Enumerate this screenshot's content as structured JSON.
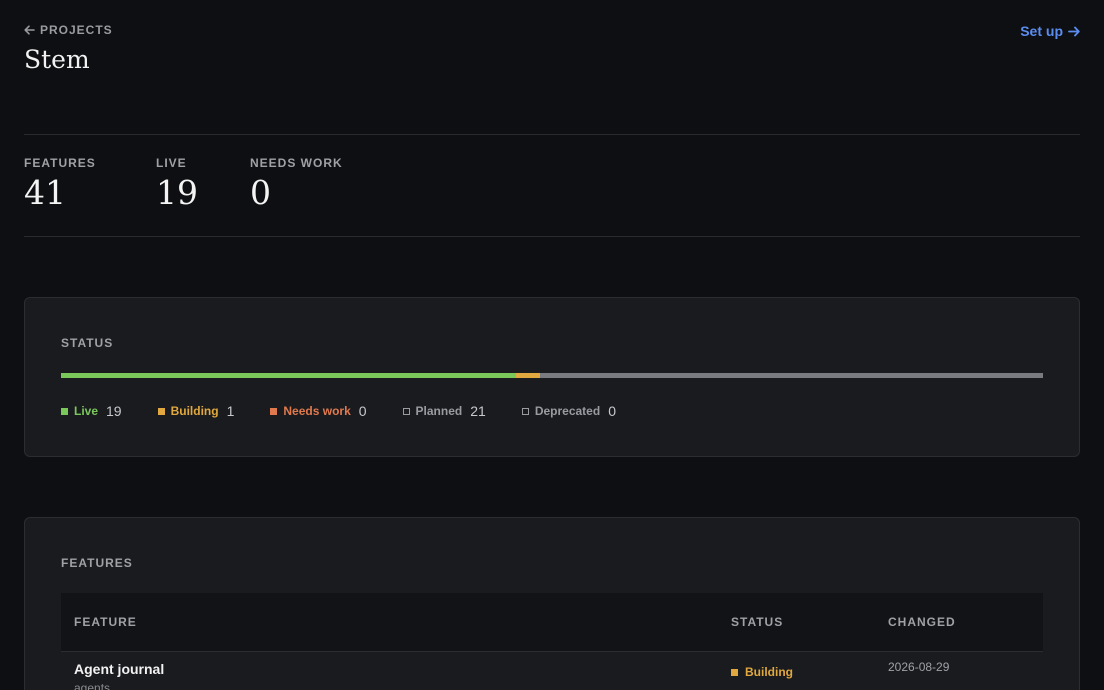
{
  "header": {
    "back_label": "PROJECTS",
    "title": "Stem",
    "setup_label": "Set up"
  },
  "stats": [
    {
      "label": "FEATURES",
      "value": "41"
    },
    {
      "label": "LIVE",
      "value": "19"
    },
    {
      "label": "NEEDS WORK",
      "value": "0"
    }
  ],
  "status_card": {
    "title": "STATUS",
    "total": 41,
    "items": [
      {
        "label": "Live",
        "count": "19",
        "value": 19,
        "color": "#7ac75a",
        "filled": true
      },
      {
        "label": "Building",
        "count": "1",
        "value": 1,
        "color": "#e0a83e",
        "filled": true
      },
      {
        "label": "Needs work",
        "count": "0",
        "value": 0,
        "color": "#e07a4e",
        "filled": true
      },
      {
        "label": "Planned",
        "count": "21",
        "value": 21,
        "color": "#9a9ba0",
        "filled": false
      },
      {
        "label": "Deprecated",
        "count": "0",
        "value": 0,
        "color": "#9a9ba0",
        "filled": false
      }
    ]
  },
  "features_card": {
    "title": "FEATURES",
    "columns": {
      "feature": "FEATURE",
      "status": "STATUS",
      "changed": "CHANGED"
    },
    "rows": [
      {
        "name": "Agent journal",
        "group": "agents",
        "status": "Building",
        "status_color": "#e0a83e",
        "changed": "2026-08-29"
      }
    ]
  }
}
